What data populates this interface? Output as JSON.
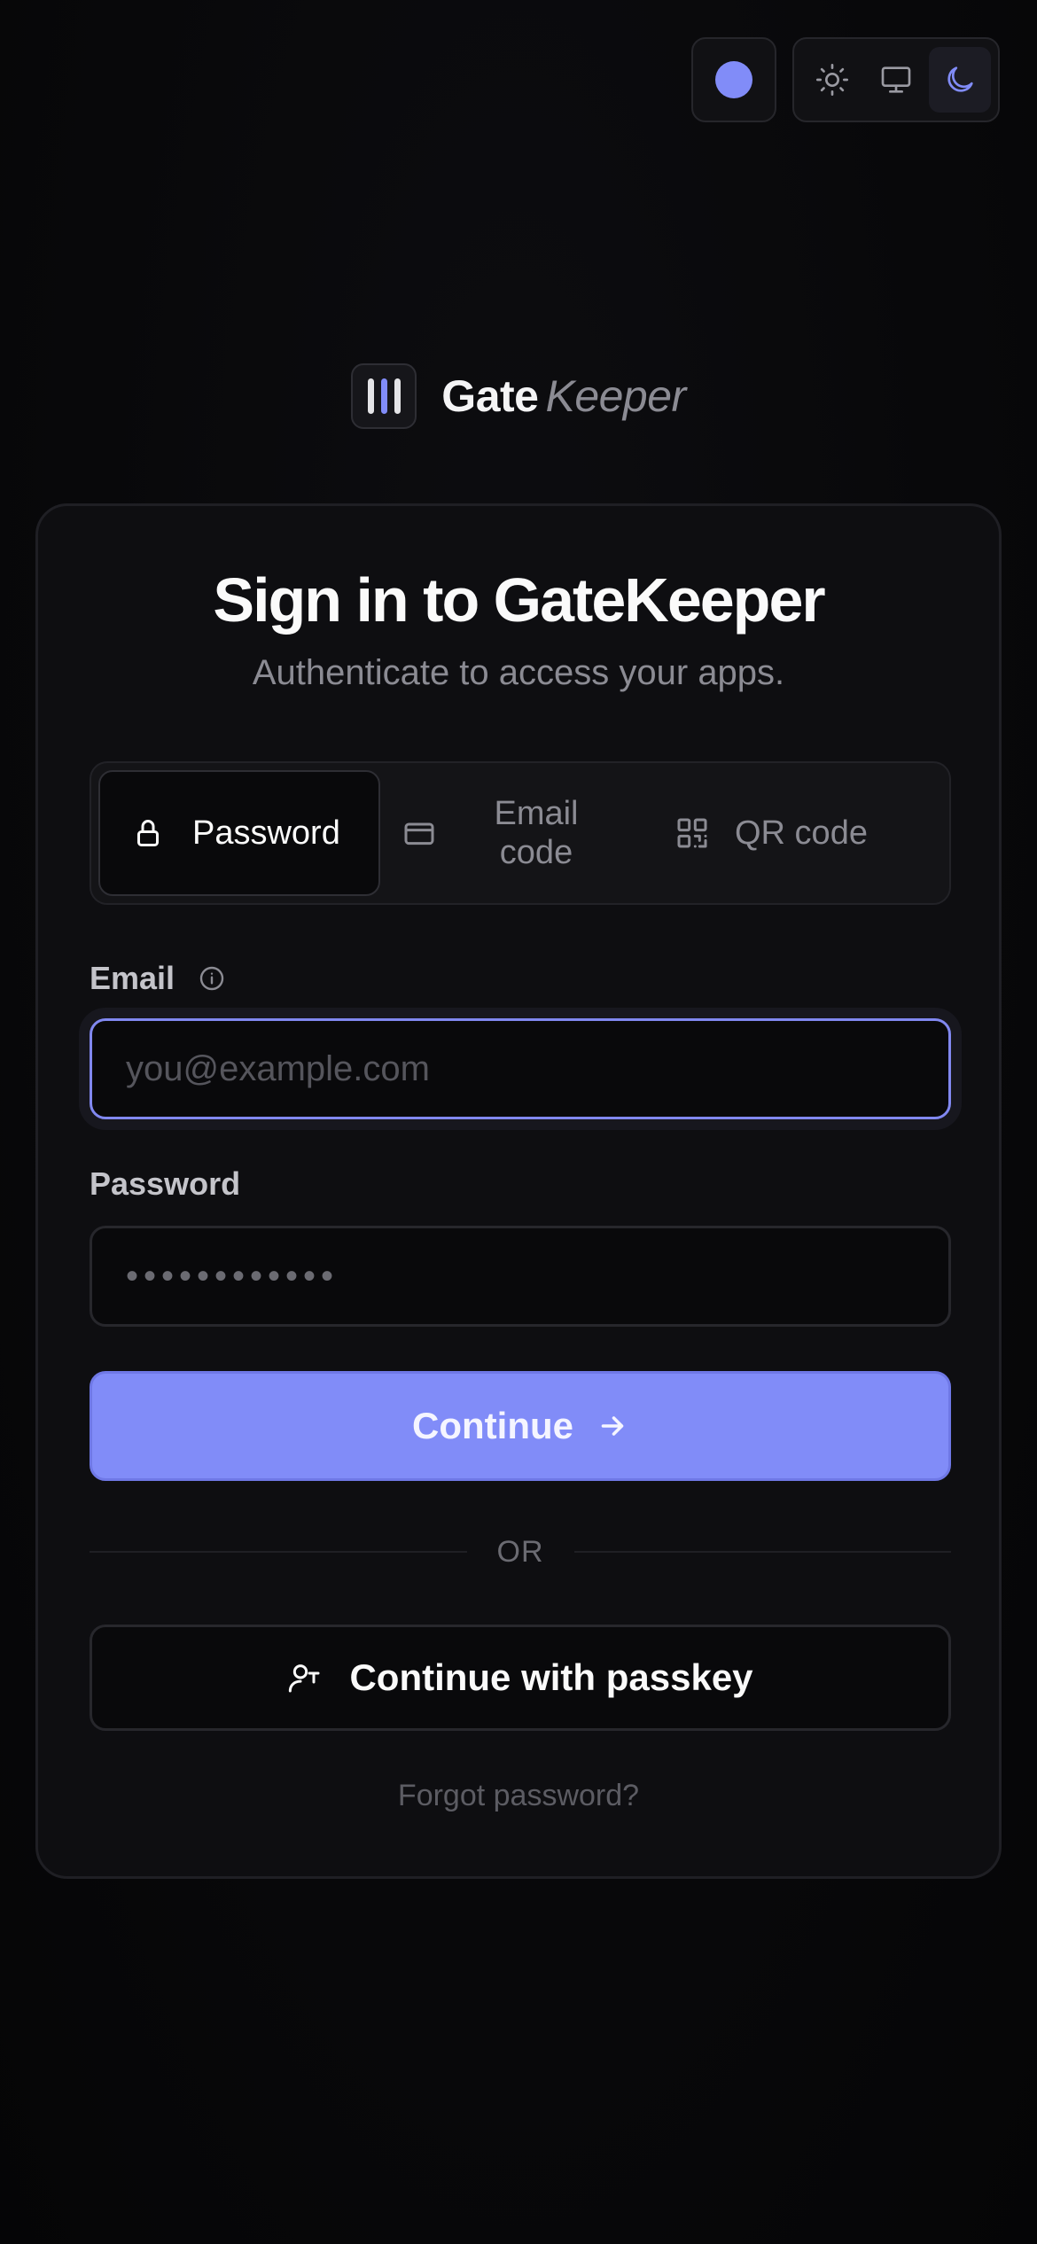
{
  "top_controls": {
    "accent_color": "#818cf8",
    "theme_options": [
      {
        "icon": "sun-icon",
        "active": false
      },
      {
        "icon": "monitor-icon",
        "active": false
      },
      {
        "icon": "moon-icon",
        "active": true
      }
    ]
  },
  "brand": {
    "name_primary": "Gate",
    "name_secondary": "Keeper"
  },
  "card": {
    "title": "Sign in to GateKeeper",
    "subtitle": "Authenticate to access your apps.",
    "tabs": [
      {
        "label": "Password",
        "icon": "lock-icon",
        "active": true
      },
      {
        "label": "Email code",
        "icon": "card-icon",
        "active": false
      },
      {
        "label": "QR code",
        "icon": "qr-code-icon",
        "active": false
      }
    ],
    "email_label": "Email",
    "email_placeholder": "you@example.com",
    "password_label": "Password",
    "password_value": "••••••••••••",
    "continue_label": "Continue",
    "divider_text": "OR",
    "passkey_label": "Continue with passkey",
    "forgot_label": "Forgot password?"
  },
  "colors": {
    "accent": "#818cf8",
    "background": "#09090b",
    "card": "#0e0e11"
  }
}
